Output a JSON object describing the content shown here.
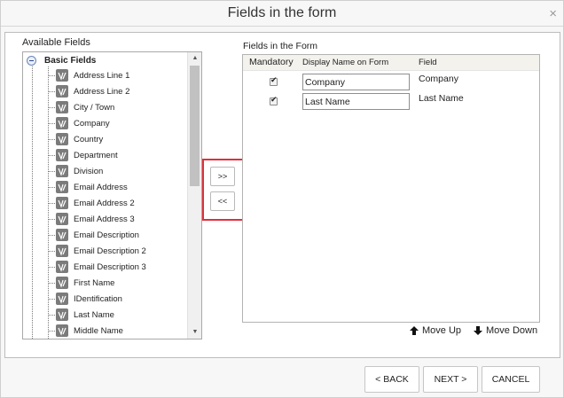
{
  "dialog": {
    "title": "Fields in the form",
    "close_glyph": "×"
  },
  "available": {
    "label": "Available Fields",
    "root_label": "Basic Fields",
    "items": [
      {
        "label": "Address Line 1"
      },
      {
        "label": "Address Line 2"
      },
      {
        "label": "City / Town"
      },
      {
        "label": "Company"
      },
      {
        "label": "Country"
      },
      {
        "label": "Department"
      },
      {
        "label": "Division"
      },
      {
        "label": "Email Address"
      },
      {
        "label": "Email Address 2"
      },
      {
        "label": "Email Address 3"
      },
      {
        "label": "Email Description"
      },
      {
        "label": "Email Description 2"
      },
      {
        "label": "Email Description 3"
      },
      {
        "label": "First Name"
      },
      {
        "label": "IDentification"
      },
      {
        "label": "Last Name"
      },
      {
        "label": "Middle Name"
      }
    ],
    "scroll_up_glyph": "▲",
    "scroll_down_glyph": "▼"
  },
  "transfer": {
    "add_label": ">>",
    "remove_label": "<<",
    "highlight_color": "#e0303b"
  },
  "form": {
    "label": "Fields in the Form",
    "columns": {
      "mandatory": "Mandatory",
      "display": "Display Name on Form",
      "field": "Field"
    },
    "rows": [
      {
        "mandatory": true,
        "display_name": "Company",
        "field": "Company"
      },
      {
        "mandatory": true,
        "display_name": "Last Name",
        "field": "Last Name"
      }
    ],
    "move_up_label": "Move Up",
    "move_down_label": "Move Down"
  },
  "footer": {
    "back_label": "< BACK",
    "next_label": "NEXT >",
    "cancel_label": "CANCEL"
  }
}
